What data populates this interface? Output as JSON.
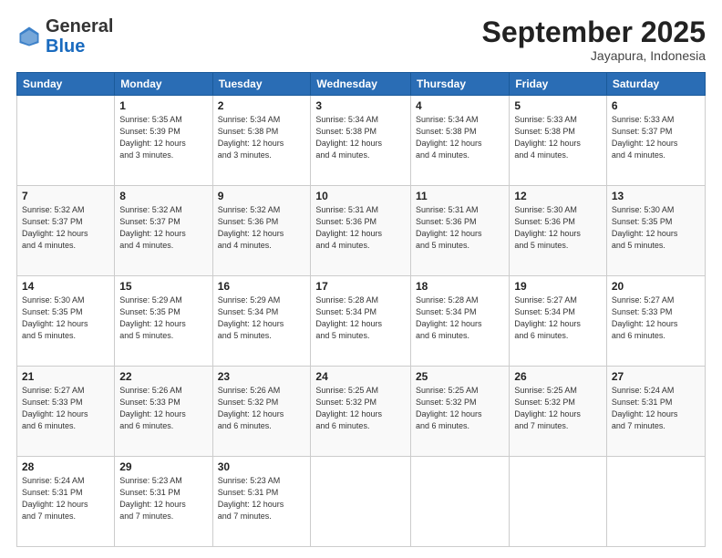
{
  "header": {
    "logo_general": "General",
    "logo_blue": "Blue",
    "month_title": "September 2025",
    "subtitle": "Jayapura, Indonesia"
  },
  "weekdays": [
    "Sunday",
    "Monday",
    "Tuesday",
    "Wednesday",
    "Thursday",
    "Friday",
    "Saturday"
  ],
  "weeks": [
    [
      {
        "day": "",
        "info": ""
      },
      {
        "day": "1",
        "info": "Sunrise: 5:35 AM\nSunset: 5:39 PM\nDaylight: 12 hours\nand 3 minutes."
      },
      {
        "day": "2",
        "info": "Sunrise: 5:34 AM\nSunset: 5:38 PM\nDaylight: 12 hours\nand 3 minutes."
      },
      {
        "day": "3",
        "info": "Sunrise: 5:34 AM\nSunset: 5:38 PM\nDaylight: 12 hours\nand 4 minutes."
      },
      {
        "day": "4",
        "info": "Sunrise: 5:34 AM\nSunset: 5:38 PM\nDaylight: 12 hours\nand 4 minutes."
      },
      {
        "day": "5",
        "info": "Sunrise: 5:33 AM\nSunset: 5:38 PM\nDaylight: 12 hours\nand 4 minutes."
      },
      {
        "day": "6",
        "info": "Sunrise: 5:33 AM\nSunset: 5:37 PM\nDaylight: 12 hours\nand 4 minutes."
      }
    ],
    [
      {
        "day": "7",
        "info": "Sunrise: 5:32 AM\nSunset: 5:37 PM\nDaylight: 12 hours\nand 4 minutes."
      },
      {
        "day": "8",
        "info": "Sunrise: 5:32 AM\nSunset: 5:37 PM\nDaylight: 12 hours\nand 4 minutes."
      },
      {
        "day": "9",
        "info": "Sunrise: 5:32 AM\nSunset: 5:36 PM\nDaylight: 12 hours\nand 4 minutes."
      },
      {
        "day": "10",
        "info": "Sunrise: 5:31 AM\nSunset: 5:36 PM\nDaylight: 12 hours\nand 4 minutes."
      },
      {
        "day": "11",
        "info": "Sunrise: 5:31 AM\nSunset: 5:36 PM\nDaylight: 12 hours\nand 5 minutes."
      },
      {
        "day": "12",
        "info": "Sunrise: 5:30 AM\nSunset: 5:36 PM\nDaylight: 12 hours\nand 5 minutes."
      },
      {
        "day": "13",
        "info": "Sunrise: 5:30 AM\nSunset: 5:35 PM\nDaylight: 12 hours\nand 5 minutes."
      }
    ],
    [
      {
        "day": "14",
        "info": "Sunrise: 5:30 AM\nSunset: 5:35 PM\nDaylight: 12 hours\nand 5 minutes."
      },
      {
        "day": "15",
        "info": "Sunrise: 5:29 AM\nSunset: 5:35 PM\nDaylight: 12 hours\nand 5 minutes."
      },
      {
        "day": "16",
        "info": "Sunrise: 5:29 AM\nSunset: 5:34 PM\nDaylight: 12 hours\nand 5 minutes."
      },
      {
        "day": "17",
        "info": "Sunrise: 5:28 AM\nSunset: 5:34 PM\nDaylight: 12 hours\nand 5 minutes."
      },
      {
        "day": "18",
        "info": "Sunrise: 5:28 AM\nSunset: 5:34 PM\nDaylight: 12 hours\nand 6 minutes."
      },
      {
        "day": "19",
        "info": "Sunrise: 5:27 AM\nSunset: 5:34 PM\nDaylight: 12 hours\nand 6 minutes."
      },
      {
        "day": "20",
        "info": "Sunrise: 5:27 AM\nSunset: 5:33 PM\nDaylight: 12 hours\nand 6 minutes."
      }
    ],
    [
      {
        "day": "21",
        "info": "Sunrise: 5:27 AM\nSunset: 5:33 PM\nDaylight: 12 hours\nand 6 minutes."
      },
      {
        "day": "22",
        "info": "Sunrise: 5:26 AM\nSunset: 5:33 PM\nDaylight: 12 hours\nand 6 minutes."
      },
      {
        "day": "23",
        "info": "Sunrise: 5:26 AM\nSunset: 5:32 PM\nDaylight: 12 hours\nand 6 minutes."
      },
      {
        "day": "24",
        "info": "Sunrise: 5:25 AM\nSunset: 5:32 PM\nDaylight: 12 hours\nand 6 minutes."
      },
      {
        "day": "25",
        "info": "Sunrise: 5:25 AM\nSunset: 5:32 PM\nDaylight: 12 hours\nand 6 minutes."
      },
      {
        "day": "26",
        "info": "Sunrise: 5:25 AM\nSunset: 5:32 PM\nDaylight: 12 hours\nand 7 minutes."
      },
      {
        "day": "27",
        "info": "Sunrise: 5:24 AM\nSunset: 5:31 PM\nDaylight: 12 hours\nand 7 minutes."
      }
    ],
    [
      {
        "day": "28",
        "info": "Sunrise: 5:24 AM\nSunset: 5:31 PM\nDaylight: 12 hours\nand 7 minutes."
      },
      {
        "day": "29",
        "info": "Sunrise: 5:23 AM\nSunset: 5:31 PM\nDaylight: 12 hours\nand 7 minutes."
      },
      {
        "day": "30",
        "info": "Sunrise: 5:23 AM\nSunset: 5:31 PM\nDaylight: 12 hours\nand 7 minutes."
      },
      {
        "day": "",
        "info": ""
      },
      {
        "day": "",
        "info": ""
      },
      {
        "day": "",
        "info": ""
      },
      {
        "day": "",
        "info": ""
      }
    ]
  ]
}
